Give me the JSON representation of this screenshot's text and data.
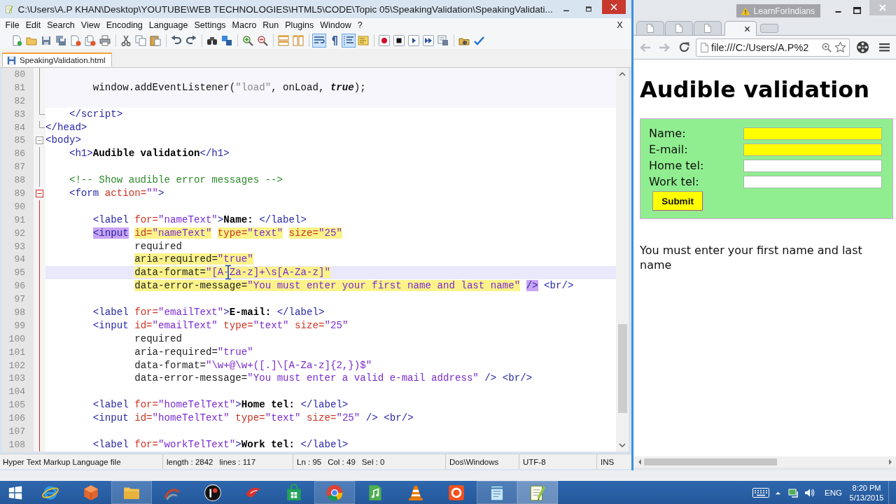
{
  "editor": {
    "title": "C:\\Users\\A.P KHAN\\Desktop\\YOUTUBE\\WEB TECHNOLOGIES\\HTML5\\CODE\\Topic 05\\SpeakingValidation\\SpeakingValidati...",
    "menu": [
      "File",
      "Edit",
      "Search",
      "View",
      "Encoding",
      "Language",
      "Settings",
      "Macro",
      "Run",
      "Plugins",
      "Window",
      "?"
    ],
    "close_label": "X",
    "toolbar_groups": [
      [
        {
          "pressed": false
        },
        {
          "pressed": false
        },
        {
          "pressed": false
        },
        {
          "pressed": false
        },
        {
          "pressed": false
        },
        {
          "pressed": false
        },
        {
          "pressed": false
        }
      ],
      [
        {
          "pressed": false
        },
        {
          "pressed": false
        },
        {
          "pressed": false
        }
      ],
      [
        {
          "pressed": false
        },
        {
          "pressed": false
        }
      ],
      [
        {
          "pressed": false
        },
        {
          "pressed": false
        }
      ],
      [
        {
          "pressed": false
        },
        {
          "pressed": false
        }
      ],
      [
        {
          "pressed": false
        },
        {
          "pressed": false
        }
      ],
      [
        {
          "pressed": true
        },
        {
          "pressed": false
        },
        {
          "pressed": true
        },
        {
          "pressed": false
        }
      ],
      [
        {
          "pressed": false
        },
        {
          "pressed": false
        },
        {
          "pressed": false
        },
        {
          "pressed": false
        },
        {
          "pressed": false
        }
      ],
      [
        {
          "pressed": false
        },
        {
          "pressed": false
        }
      ]
    ],
    "tabs": [
      {
        "label": "SpeakingValidation.html",
        "selected": true
      }
    ],
    "lines": [
      {
        "number": "80",
        "kind": "script",
        "current": false,
        "fold": {
          "kind": "line",
          "active": false
        }
      },
      {
        "number": "81",
        "kind": "script",
        "current": false,
        "fold": {
          "kind": "line",
          "active": false
        },
        "tokens": [
          {
            "text": "        window.addEventListener(",
            "kind": "code",
            "marked": false
          },
          {
            "text": "\"load\"",
            "kind": "string",
            "marked": false
          },
          {
            "text": ", onLoad, ",
            "kind": "code",
            "marked": false
          },
          {
            "text": "true",
            "kind": "keyword",
            "marked": false
          },
          {
            "text": ");",
            "kind": "code",
            "marked": false
          }
        ]
      },
      {
        "number": "82",
        "kind": "script",
        "current": false,
        "fold": {
          "kind": "line",
          "active": false
        }
      },
      {
        "number": "83",
        "kind": "markup",
        "current": false,
        "fold": {
          "kind": "end",
          "active": false
        },
        "tokens": [
          {
            "text": "    </script>",
            "kind": "tag",
            "marked": false
          }
        ]
      },
      {
        "number": "84",
        "kind": "markup",
        "current": false,
        "fold": {
          "kind": "end",
          "active": false
        },
        "tokens": [
          {
            "text": "</head>",
            "kind": "tag",
            "marked": false
          }
        ]
      },
      {
        "number": "85",
        "kind": "markup",
        "current": false,
        "fold": {
          "kind": "box",
          "active": false
        },
        "tokens": [
          {
            "text": "<body>",
            "kind": "tag",
            "marked": false
          }
        ]
      },
      {
        "number": "86",
        "kind": "markup",
        "current": false,
        "fold": {
          "kind": "line",
          "active": false
        },
        "tokens": [
          {
            "text": "    <h1>",
            "kind": "tag",
            "marked": false
          },
          {
            "text": "Audible validation",
            "kind": "text",
            "marked": false
          },
          {
            "text": "</h1>",
            "kind": "tag",
            "marked": false
          }
        ]
      },
      {
        "number": "87",
        "kind": "markup",
        "current": false,
        "fold": {
          "kind": "line",
          "active": false
        }
      },
      {
        "number": "88",
        "kind": "markup",
        "current": false,
        "fold": {
          "kind": "line",
          "active": false
        },
        "tokens": [
          {
            "text": "    <!-- Show audible error messages -->",
            "kind": "comment",
            "marked": false
          }
        ]
      },
      {
        "number": "89",
        "kind": "markup",
        "current": false,
        "fold": {
          "kind": "box",
          "active": true
        },
        "tokens": [
          {
            "text": "    <form",
            "kind": "tag",
            "marked": false
          },
          {
            "text": " action=",
            "kind": "attr",
            "marked": false
          },
          {
            "text": "\"\"",
            "kind": "value",
            "marked": false
          },
          {
            "text": ">",
            "kind": "tag",
            "marked": false
          }
        ]
      },
      {
        "number": "90",
        "kind": "markup",
        "current": false,
        "fold": {
          "kind": "line",
          "active": true
        }
      },
      {
        "number": "91",
        "kind": "markup",
        "current": false,
        "fold": {
          "kind": "line",
          "active": true
        },
        "tokens": [
          {
            "text": "        <label",
            "kind": "tag",
            "marked": false
          },
          {
            "text": " for=",
            "kind": "attr",
            "marked": false
          },
          {
            "text": "\"nameText\"",
            "kind": "value",
            "marked": false
          },
          {
            "text": ">",
            "kind": "tag",
            "marked": false
          },
          {
            "text": "Name: ",
            "kind": "text",
            "marked": false
          },
          {
            "text": "</label>",
            "kind": "tag",
            "marked": false
          }
        ]
      },
      {
        "number": "92",
        "kind": "markup",
        "current": false,
        "fold": {
          "kind": "line",
          "active": true
        },
        "tokens": [
          {
            "text": "        <input",
            "kind": "tag",
            "marked": true
          },
          {
            "text": " id=",
            "kind": "attr",
            "marked": true
          },
          {
            "text": "\"nameText\"",
            "kind": "value",
            "marked": true
          },
          {
            "text": " type=",
            "kind": "attr",
            "marked": true
          },
          {
            "text": "\"text\"",
            "kind": "value",
            "marked": true
          },
          {
            "text": " size=",
            "kind": "attr",
            "marked": true
          },
          {
            "text": "\"25\"",
            "kind": "value",
            "marked": true
          }
        ]
      },
      {
        "number": "93",
        "kind": "markup",
        "current": false,
        "fold": {
          "kind": "line",
          "active": true
        },
        "tokens": [
          {
            "text": "               required",
            "kind": "other",
            "marked": false
          }
        ]
      },
      {
        "number": "94",
        "kind": "markup",
        "current": false,
        "fold": {
          "kind": "line",
          "active": true
        },
        "tokens": [
          {
            "text": "               aria-required=",
            "kind": "other",
            "marked": true
          },
          {
            "text": "\"true\"",
            "kind": "value",
            "marked": true
          }
        ]
      },
      {
        "number": "95",
        "kind": "markup",
        "current": true,
        "fold": {
          "kind": "line",
          "active": true
        },
        "tokens": [
          {
            "text": "               data-format=",
            "kind": "other",
            "marked": true
          },
          {
            "text": "\"[A-Za-z]+\\s[A-Za-z]\"",
            "kind": "value",
            "marked": true
          }
        ]
      },
      {
        "number": "96",
        "kind": "markup",
        "current": false,
        "fold": {
          "kind": "line",
          "active": true
        },
        "tokens": [
          {
            "text": "               data-error-message=",
            "kind": "other",
            "marked": true
          },
          {
            "text": "\"You must enter your first name and last name\"",
            "kind": "value",
            "marked": true
          },
          {
            "text": " />",
            "kind": "tag",
            "marked": true
          },
          {
            "text": " <br/>",
            "kind": "tag",
            "marked": false
          }
        ]
      },
      {
        "number": "97",
        "kind": "markup",
        "current": false,
        "fold": {
          "kind": "line",
          "active": true
        }
      },
      {
        "number": "98",
        "kind": "markup",
        "current": false,
        "fold": {
          "kind": "line",
          "active": true
        },
        "tokens": [
          {
            "text": "        <label",
            "kind": "tag",
            "marked": false
          },
          {
            "text": " for=",
            "kind": "attr",
            "marked": false
          },
          {
            "text": "\"emailText\"",
            "kind": "value",
            "marked": false
          },
          {
            "text": ">",
            "kind": "tag",
            "marked": false
          },
          {
            "text": "E-mail: ",
            "kind": "text",
            "marked": false
          },
          {
            "text": "</label>",
            "kind": "tag",
            "marked": false
          }
        ]
      },
      {
        "number": "99",
        "kind": "markup",
        "current": false,
        "fold": {
          "kind": "line",
          "active": true
        },
        "tokens": [
          {
            "text": "        <input",
            "kind": "tag",
            "marked": false
          },
          {
            "text": " id=",
            "kind": "attr",
            "marked": false
          },
          {
            "text": "\"emailText\"",
            "kind": "value",
            "marked": false
          },
          {
            "text": " type=",
            "kind": "attr",
            "marked": false
          },
          {
            "text": "\"text\"",
            "kind": "value",
            "marked": false
          },
          {
            "text": " size=",
            "kind": "attr",
            "marked": false
          },
          {
            "text": "\"25\"",
            "kind": "value",
            "marked": false
          }
        ]
      },
      {
        "number": "100",
        "kind": "markup",
        "current": false,
        "fold": {
          "kind": "line",
          "active": true
        },
        "tokens": [
          {
            "text": "               required",
            "kind": "other",
            "marked": false
          }
        ]
      },
      {
        "number": "101",
        "kind": "markup",
        "current": false,
        "fold": {
          "kind": "line",
          "active": true
        },
        "tokens": [
          {
            "text": "               aria-required=",
            "kind": "other",
            "marked": false
          },
          {
            "text": "\"true\"",
            "kind": "value",
            "marked": false
          }
        ]
      },
      {
        "number": "102",
        "kind": "markup",
        "current": false,
        "fold": {
          "kind": "line",
          "active": true
        },
        "tokens": [
          {
            "text": "               data-format=",
            "kind": "other",
            "marked": false
          },
          {
            "text": "\"\\w+@\\w+([.]\\[A-Za-z]{2,})$\"",
            "kind": "value",
            "marked": false
          }
        ]
      },
      {
        "number": "103",
        "kind": "markup",
        "current": false,
        "fold": {
          "kind": "line",
          "active": true
        },
        "tokens": [
          {
            "text": "               data-error-message=",
            "kind": "other",
            "marked": false
          },
          {
            "text": "\"You must enter a valid e-mail address\"",
            "kind": "value",
            "marked": false
          },
          {
            "text": " />",
            "kind": "tag",
            "marked": false
          },
          {
            "text": " <br/>",
            "kind": "tag",
            "marked": false
          }
        ]
      },
      {
        "number": "104",
        "kind": "markup",
        "current": false,
        "fold": {
          "kind": "line",
          "active": true
        }
      },
      {
        "number": "105",
        "kind": "markup",
        "current": false,
        "fold": {
          "kind": "line",
          "active": true
        },
        "tokens": [
          {
            "text": "        <label",
            "kind": "tag",
            "marked": false
          },
          {
            "text": " for=",
            "kind": "attr",
            "marked": false
          },
          {
            "text": "\"homeTelText\"",
            "kind": "value",
            "marked": false
          },
          {
            "text": ">",
            "kind": "tag",
            "marked": false
          },
          {
            "text": "Home tel: ",
            "kind": "text",
            "marked": false
          },
          {
            "text": "</label>",
            "kind": "tag",
            "marked": false
          }
        ]
      },
      {
        "number": "106",
        "kind": "markup",
        "current": false,
        "fold": {
          "kind": "line",
          "active": true
        },
        "tokens": [
          {
            "text": "        <input",
            "kind": "tag",
            "marked": false
          },
          {
            "text": " id=",
            "kind": "attr",
            "marked": false
          },
          {
            "text": "\"homeTelText\"",
            "kind": "value",
            "marked": false
          },
          {
            "text": " type=",
            "kind": "attr",
            "marked": false
          },
          {
            "text": "\"text\"",
            "kind": "value",
            "marked": false
          },
          {
            "text": " size=",
            "kind": "attr",
            "marked": false
          },
          {
            "text": "\"25\"",
            "kind": "value",
            "marked": false
          },
          {
            "text": " />",
            "kind": "tag",
            "marked": false
          },
          {
            "text": " <br/>",
            "kind": "tag",
            "marked": false
          }
        ]
      },
      {
        "number": "107",
        "kind": "markup",
        "current": false,
        "fold": {
          "kind": "line",
          "active": true
        }
      },
      {
        "number": "108",
        "kind": "markup",
        "current": false,
        "fold": {
          "kind": "line",
          "active": true
        },
        "tokens": [
          {
            "text": "        <label",
            "kind": "tag",
            "marked": false
          },
          {
            "text": " for=",
            "kind": "attr",
            "marked": false
          },
          {
            "text": "\"workTelText\"",
            "kind": "value",
            "marked": false
          },
          {
            "text": ">",
            "kind": "tag",
            "marked": false
          },
          {
            "text": "Work tel: ",
            "kind": "text",
            "marked": false
          },
          {
            "text": "</label>",
            "kind": "tag",
            "marked": false
          }
        ]
      }
    ],
    "status_bar": [
      [
        "Hyper Text Markup Language file"
      ],
      [
        "length : 2842",
        "lines : 117"
      ],
      [
        "Ln : 95",
        "Col : 49",
        "Sel : 0"
      ],
      [
        "Dos\\Windows"
      ],
      [
        "UTF-8"
      ],
      [
        "INS"
      ]
    ]
  },
  "browser": {
    "profile": "LearnForIndians",
    "tabs": [
      {
        "selected": false
      },
      {
        "selected": false
      },
      {
        "selected": false
      },
      {
        "selected": true
      }
    ],
    "nav_buttons": [
      {
        "disabled": true
      },
      {
        "disabled": true
      }
    ],
    "address": "file:///C:/Users/A.P%2",
    "page": {
      "heading": "Audible validation",
      "fields": [
        {
          "label": "Name:",
          "invalid": true
        },
        {
          "label": "E-mail:",
          "invalid": true
        },
        {
          "label": "Home tel:",
          "invalid": false
        },
        {
          "label": "Work tel:",
          "invalid": false
        }
      ],
      "submit": "Submit",
      "message": "You must enter your first name and last name"
    }
  },
  "taskbar": {
    "apps": [
      {
        "running": false,
        "selected": false
      },
      {
        "running": false,
        "selected": false
      },
      {
        "running": true,
        "selected": false
      },
      {
        "running": false,
        "selected": false
      },
      {
        "running": false,
        "selected": false
      },
      {
        "running": false,
        "selected": false
      },
      {
        "running": false,
        "selected": false
      },
      {
        "running": true,
        "selected": false
      },
      {
        "running": false,
        "selected": false
      },
      {
        "running": false,
        "selected": false
      },
      {
        "running": false,
        "selected": false
      },
      {
        "running": true,
        "selected": false
      },
      {
        "running": true,
        "selected": true
      }
    ],
    "language": "ENG",
    "time": "8:20 PM",
    "date": "5/13/2015"
  }
}
